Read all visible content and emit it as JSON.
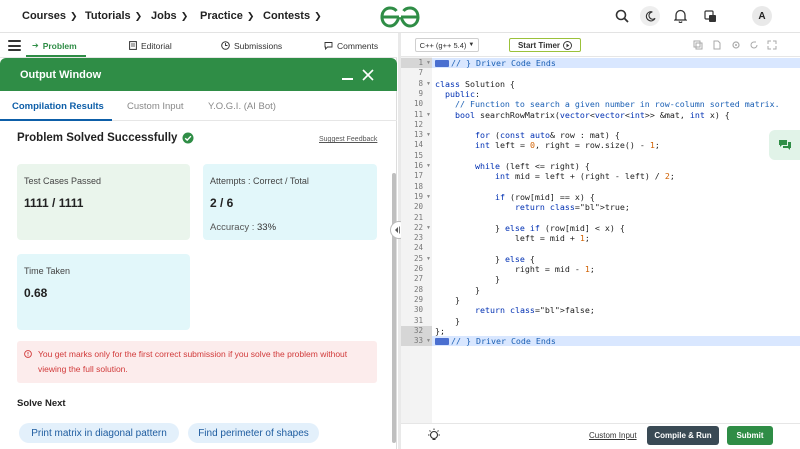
{
  "nav": {
    "items": [
      {
        "label": "Courses"
      },
      {
        "label": "Tutorials"
      },
      {
        "label": "Jobs"
      },
      {
        "label": "Practice"
      },
      {
        "label": "Contests"
      }
    ],
    "avatar_letter": "A",
    "brand_color": "#2f8d46"
  },
  "left_tabs": {
    "items": [
      {
        "label": "Problem",
        "icon": "problem-icon"
      },
      {
        "label": "Editorial",
        "icon": "editorial-icon"
      },
      {
        "label": "Submissions",
        "icon": "submissions-icon"
      },
      {
        "label": "Comments",
        "icon": "comments-icon"
      }
    ]
  },
  "output_window": {
    "title": "Output Window",
    "tabs": [
      {
        "label": "Compilation Results"
      },
      {
        "label": "Custom Input"
      },
      {
        "label": "Y.O.G.I. (AI Bot)"
      }
    ],
    "status_title": "Problem Solved Successfully",
    "suggest_feedback": "Suggest Feedback",
    "test_cases": {
      "label": "Test Cases Passed",
      "value": "1111 / 1111"
    },
    "attempts": {
      "label": "Attempts : Correct / Total",
      "value": "2 / 6",
      "accuracy_label": "Accuracy :",
      "accuracy_value": "33%"
    },
    "time_taken": {
      "label": "Time Taken",
      "value": "0.68"
    },
    "warning": "You get marks only for the first correct submission if you solve the problem without viewing the full solution.",
    "solve_next_title": "Solve Next",
    "solve_next": [
      {
        "label": "Print matrix in diagonal pattern"
      },
      {
        "label": "Find perimeter of shapes"
      }
    ]
  },
  "editor": {
    "language": "C++ (g++ 5.4)",
    "timer_label": "Start Timer",
    "lines": [
      {
        "n": "1",
        "text": "// } Driver Code Ends",
        "highlight": true,
        "fold": true
      },
      {
        "n": "7",
        "text": ""
      },
      {
        "n": "8",
        "text": "class Solution {",
        "fold": true
      },
      {
        "n": "9",
        "text": "  public:"
      },
      {
        "n": "10",
        "text": "    // Function to search a given number in row-column sorted matrix."
      },
      {
        "n": "11",
        "text": "    bool searchRowMatrix(vector<vector<int>> &mat, int x) {",
        "fold": true
      },
      {
        "n": "12",
        "text": ""
      },
      {
        "n": "13",
        "text": "        for (const auto& row : mat) {",
        "fold": true
      },
      {
        "n": "14",
        "text": "        int left = 0, right = row.size() - 1;"
      },
      {
        "n": "15",
        "text": ""
      },
      {
        "n": "16",
        "text": "        while (left <= right) {",
        "fold": true
      },
      {
        "n": "17",
        "text": "            int mid = left + (right - left) / 2;"
      },
      {
        "n": "18",
        "text": ""
      },
      {
        "n": "19",
        "text": "            if (row[mid] == x) {",
        "fold": true
      },
      {
        "n": "20",
        "text": "                return true;"
      },
      {
        "n": "21",
        "text": ""
      },
      {
        "n": "22",
        "text": "            } else if (row[mid] < x) {",
        "fold": true
      },
      {
        "n": "23",
        "text": "                left = mid + 1;"
      },
      {
        "n": "24",
        "text": ""
      },
      {
        "n": "25",
        "text": "            } else {",
        "fold": true
      },
      {
        "n": "26",
        "text": "                right = mid - 1;"
      },
      {
        "n": "27",
        "text": "            }"
      },
      {
        "n": "28",
        "text": "        }"
      },
      {
        "n": "29",
        "text": "    }"
      },
      {
        "n": "30",
        "text": "        return false;"
      },
      {
        "n": "31",
        "text": "    }"
      },
      {
        "n": "32",
        "text": "};",
        "highlight_gutter": true
      },
      {
        "n": "33",
        "text": "// } Driver Code Ends",
        "highlight": true,
        "fold": true
      }
    ]
  },
  "bottom_bar": {
    "custom_input": "Custom Input",
    "compile_run": "Compile & Run",
    "submit": "Submit"
  }
}
